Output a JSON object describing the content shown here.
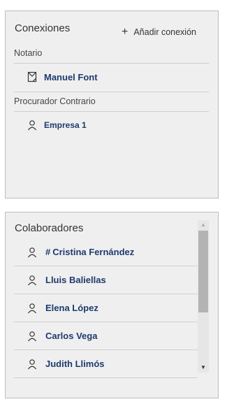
{
  "conexiones": {
    "title": "Conexiones",
    "add_label": "Añadir conexión",
    "sections": [
      {
        "label": "Notario",
        "items": [
          {
            "name": "Manuel Font",
            "icon": "document-icon"
          }
        ]
      },
      {
        "label": "Procurador Contrario",
        "items": [
          {
            "name": "Empresa 1",
            "icon": "person-icon"
          }
        ]
      }
    ]
  },
  "colaboradores": {
    "title": "Colaboradores",
    "items": [
      {
        "prefix": "#",
        "name": "Cristina Fernández",
        "icon": "person-icon"
      },
      {
        "prefix": "",
        "name": "Lluis Baliellas",
        "icon": "person-icon"
      },
      {
        "prefix": "",
        "name": "Elena López",
        "icon": "person-icon"
      },
      {
        "prefix": "",
        "name": "Carlos Vega",
        "icon": "person-icon"
      },
      {
        "prefix": "",
        "name": "Judith Llimós",
        "icon": "person-icon"
      }
    ]
  },
  "colors": {
    "link": "#1e3a6e",
    "panel_bg": "#efefef",
    "border": "#bdbdbd"
  }
}
